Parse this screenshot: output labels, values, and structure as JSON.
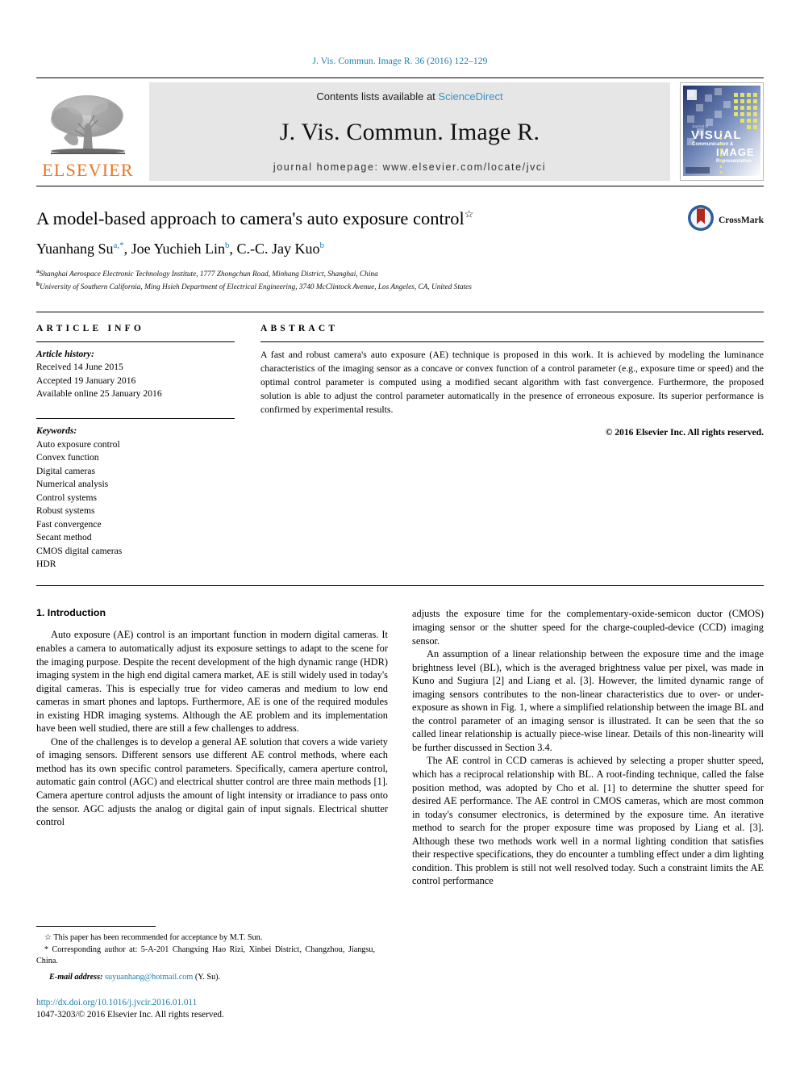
{
  "running_head": "J. Vis. Commun. Image R. 36 (2016) 122–129",
  "masthead": {
    "contents_prefix": "Contents lists available at ",
    "sciencedirect": "ScienceDirect",
    "journal_title": "J. Vis. Commun. Image R.",
    "homepage": "journal homepage: www.elsevier.com/locate/jvci",
    "publisher_logo_word": "ELSEVIER",
    "cover_lines": {
      "l1": "Journal of",
      "l2": "VISUAL",
      "l3": "Communication &",
      "l4": "IMAGE",
      "l5": "Representation"
    }
  },
  "colors": {
    "accent_link": "#1a7fa8",
    "sciencedirect_blue": "#3d8fbf",
    "elsevier_orange": "#E87722",
    "masthead_grey": "#e6e6e6",
    "crossmark_blue": "#2c5f9e",
    "crossmark_red": "#b3281e"
  },
  "article": {
    "title": "A model-based approach to camera's auto exposure control",
    "title_marker": "☆",
    "authors_html_parts": [
      {
        "name": "Yuanhang Su",
        "sup": "a,*"
      },
      {
        "name": "Joe Yuchieh Lin",
        "sup": "b"
      },
      {
        "name": "C.-C. Jay Kuo",
        "sup": "b"
      }
    ],
    "affiliations": [
      {
        "marker": "a",
        "text": "Shanghai Aerospace Electronic Technology Institute, 1777 Zhongchun Road, Minhang District, Shanghai, China"
      },
      {
        "marker": "b",
        "text": "University of Southern California, Ming Hsieh Department of Electrical Engineering, 3740 McClintock Avenue, Los Angeles, CA, United States"
      }
    ],
    "crossmark_label": "CrossMark"
  },
  "article_info": {
    "heading": "ARTICLE INFO",
    "history_label": "Article history:",
    "history": [
      "Received 14 June 2015",
      "Accepted 19 January 2016",
      "Available online 25 January 2016"
    ],
    "keywords_label": "Keywords:",
    "keywords": [
      "Auto exposure control",
      "Convex function",
      "Digital cameras",
      "Numerical analysis",
      "Control systems",
      "Robust systems",
      "Fast convergence",
      "Secant method",
      "CMOS digital cameras",
      "HDR"
    ]
  },
  "abstract": {
    "heading": "ABSTRACT",
    "text": "A fast and robust camera's auto exposure (AE) technique is proposed in this work. It is achieved by modeling the luminance characteristics of the imaging sensor as a concave or convex function of a control parameter (e.g., exposure time or speed) and the optimal control parameter is computed using a modified secant algorithm with fast convergence. Furthermore, the proposed solution is able to adjust the control parameter automatically in the presence of erroneous exposure. Its superior performance is confirmed by experimental results.",
    "copyright": "© 2016 Elsevier Inc. All rights reserved."
  },
  "body": {
    "section_heading": "1. Introduction",
    "left_paragraphs": [
      "Auto exposure (AE) control is an important function in modern digital cameras. It enables a camera to automatically adjust its exposure settings to adapt to the scene for the imaging purpose. Despite the recent development of the high dynamic range (HDR) imaging system in the high end digital camera market, AE is still widely used in today's digital cameras. This is especially true for video cameras and medium to low end cameras in smart phones and laptops. Furthermore, AE is one of the required modules in existing HDR imaging systems. Although the AE problem and its implementation have been well studied, there are still a few challenges to address.",
      "One of the challenges is to develop a general AE solution that covers a wide variety of imaging sensors. Different sensors use different AE control methods, where each method has its own specific control parameters. Specifically, camera aperture control, automatic gain control (AGC) and electrical shutter control are three main methods [1]. Camera aperture control adjusts the amount of light intensity or irradiance to pass onto the sensor. AGC adjusts the analog or digital gain of input signals. Electrical shutter control"
    ],
    "right_paragraphs": [
      "adjusts the exposure time for the complementary-oxide-semicon ductor (CMOS) imaging sensor or the shutter speed for the charge-coupled-device (CCD) imaging sensor.",
      "An assumption of a linear relationship between the exposure time and the image brightness level (BL), which is the averaged brightness value per pixel, was made in Kuno and Sugiura [2] and Liang et al. [3]. However, the limited dynamic range of imaging sensors contributes to the non-linear characteristics due to over- or under-exposure as shown in Fig. 1, where a simplified relationship between the image BL and the control parameter of an imaging sensor is illustrated. It can be seen that the so called linear relationship is actually piece-wise linear. Details of this non-linearity will be further discussed in Section 3.4.",
      "The AE control in CCD cameras is achieved by selecting a proper shutter speed, which has a reciprocal relationship with BL. A root-finding technique, called the false position method, was adopted by Cho et al. [1] to determine the shutter speed for desired AE performance. The AE control in CMOS cameras, which are most common in today's consumer electronics, is determined by the exposure time. An iterative method to search for the proper exposure time was proposed by Liang et al. [3]. Although these two methods work well in a normal lighting condition that satisfies their respective specifications, they do encounter a tumbling effect under a dim lighting condition. This problem is still not well resolved today. Such a constraint limits the AE control performance"
    ]
  },
  "footer": {
    "footnote_star": "☆",
    "footnote_star_text": "This paper has been recommended for acceptance by M.T. Sun.",
    "footnote_corr_marker": "*",
    "footnote_corr_text": "Corresponding author at: 5-A-201 Changxing Hao Rizi, Xinbei District, Changzhou, Jiangsu, China.",
    "email_label": "E-mail address:",
    "email": "suyuanhang@hotmail.com",
    "email_suffix": "(Y. Su).",
    "doi": "http://dx.doi.org/10.1016/j.jvcir.2016.01.011",
    "issn_copyright": "1047-3203/© 2016 Elsevier Inc. All rights reserved."
  }
}
